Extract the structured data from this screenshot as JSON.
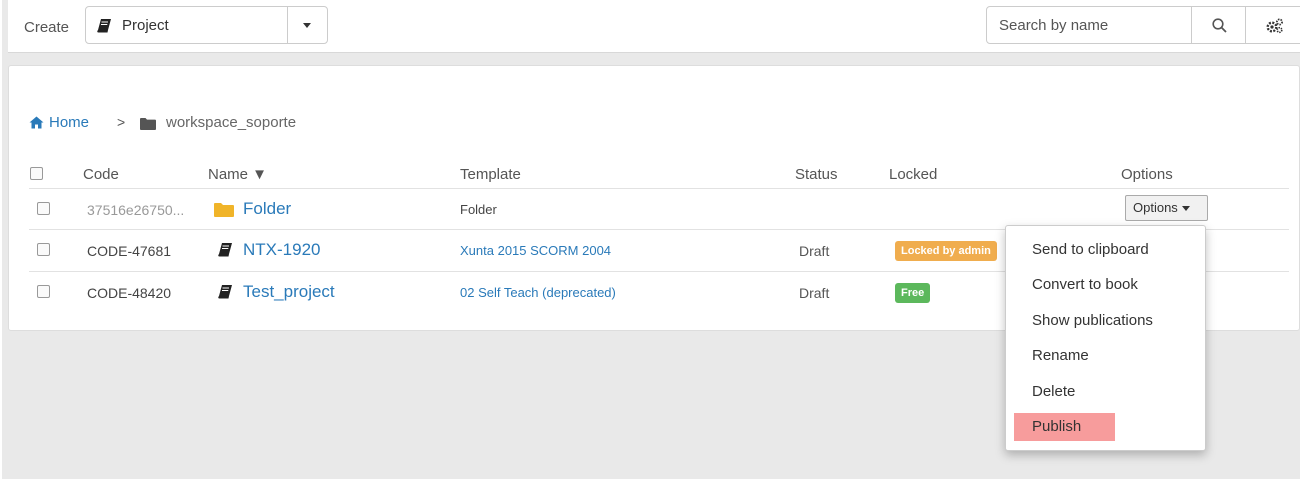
{
  "toolbar": {
    "create_label": "Create",
    "create_value": "Project",
    "search_placeholder": "Search by name"
  },
  "breadcrumb": {
    "home": "Home",
    "separator": ">",
    "current": "workspace_soporte"
  },
  "table": {
    "headers": {
      "code": "Code",
      "name": "Name ▼",
      "template": "Template",
      "status": "Status",
      "locked": "Locked",
      "options": "Options"
    },
    "rows": [
      {
        "code": "37516e26750...",
        "name": "Folder",
        "template": "Folder",
        "status": "",
        "locked": "",
        "type": "folder"
      },
      {
        "code": "CODE-47681",
        "name": "NTX-1920",
        "template": "Xunta 2015 SCORM 2004",
        "status": "Draft",
        "locked": "Locked by admin",
        "type": "project"
      },
      {
        "code": "CODE-48420",
        "name": "Test_project",
        "template": "02 Self Teach (deprecated)",
        "status": "Draft",
        "locked": "Free",
        "type": "project"
      }
    ],
    "options_button": "Options"
  },
  "menu": {
    "items": [
      "Send to clipboard",
      "Convert to book",
      "Show publications",
      "Rename",
      "Delete",
      "Publish"
    ],
    "highlighted": "Publish"
  },
  "colors": {
    "link": "#2a7ab9",
    "folder": "#f0b429",
    "locked_badge": "#f0ad4e",
    "free_badge": "#5cb85c",
    "highlight": "#f79c9c"
  }
}
